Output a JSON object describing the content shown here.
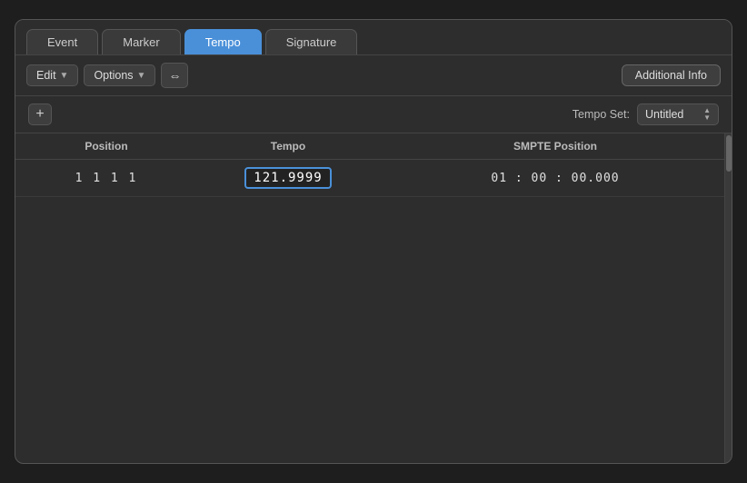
{
  "tabs": [
    {
      "id": "event",
      "label": "Event",
      "active": false
    },
    {
      "id": "marker",
      "label": "Marker",
      "active": false
    },
    {
      "id": "tempo",
      "label": "Tempo",
      "active": true
    },
    {
      "id": "signature",
      "label": "Signature",
      "active": false
    }
  ],
  "toolbar": {
    "edit_label": "Edit",
    "options_label": "Options",
    "snap_icon": "⇔",
    "additional_info_label": "Additional Info"
  },
  "tempo_set": {
    "label": "Tempo Set:",
    "value": "Untitled"
  },
  "add_button_label": "+",
  "table": {
    "headers": [
      "Position",
      "Tempo",
      "SMPTE Position"
    ],
    "rows": [
      {
        "position": "1  1  1       1",
        "tempo": "121.9999",
        "smpte": "01 : 00 : 00.000"
      }
    ]
  }
}
